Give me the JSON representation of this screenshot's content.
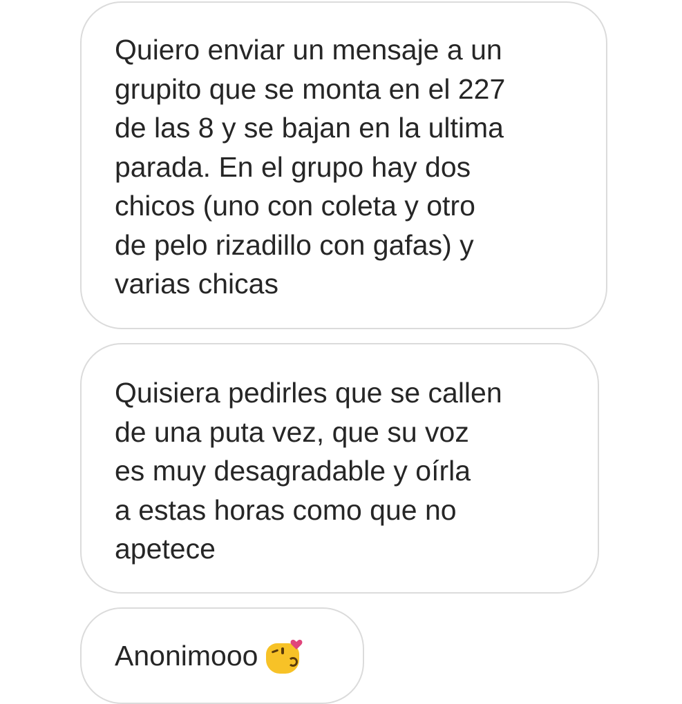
{
  "messages": [
    {
      "text": "Quiero enviar un mensaje a un\ngrupito que se monta en el 227\nde las 8 y se bajan en la ultima\nparada. En el grupo hay dos\nchicos (uno con coleta y otro\nde pelo rizadillo con gafas) y\nvarias chicas"
    },
    {
      "text": "Quisiera pedirles que se callen\nde una puta vez, que su voz\nes muy desagradable y oírla\na estas horas como que no\napetece"
    },
    {
      "text": "Anonimooo",
      "emoji": "kissing-face-with-heart-emoji"
    }
  ],
  "colors": {
    "bubble_border": "#dbdbdb",
    "text": "#262626",
    "emoji_face": "#f7c227",
    "emoji_heart": "#e0457b"
  }
}
